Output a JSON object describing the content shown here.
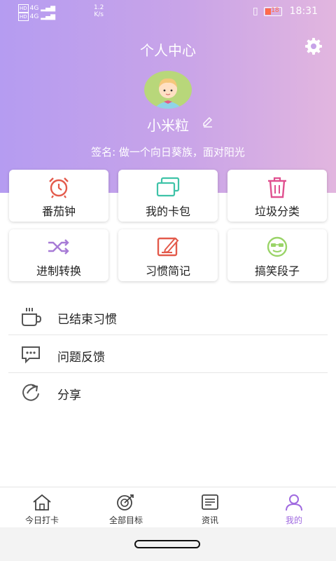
{
  "status_bar": {
    "sim1": "HD",
    "sim2": "HD",
    "net1": "4G",
    "net2": "4G",
    "speed_value": "1.2",
    "speed_unit": "K/s",
    "battery": "18",
    "time": "18:31"
  },
  "header": {
    "title": "个人中心",
    "username": "小米粒",
    "signature": "签名: 做一个向日葵族，面对阳光"
  },
  "grid": [
    {
      "label": "番茄钟",
      "icon": "alarm-clock-icon",
      "color": "#e35a4b"
    },
    {
      "label": "我的卡包",
      "icon": "cards-icon",
      "color": "#3fc3a8"
    },
    {
      "label": "垃圾分类",
      "icon": "trash-icon",
      "color": "#e0508f"
    },
    {
      "label": "进制转换",
      "icon": "shuffle-icon",
      "color": "#a77bd6"
    },
    {
      "label": "习惯简记",
      "icon": "notepad-icon",
      "color": "#e35a4b"
    },
    {
      "label": "搞笑段子",
      "icon": "smiley-icon",
      "color": "#9ad468"
    }
  ],
  "list": [
    {
      "label": "已结束习惯",
      "icon": "cup-icon"
    },
    {
      "label": "问题反馈",
      "icon": "feedback-icon"
    },
    {
      "label": "分享",
      "icon": "share-icon"
    }
  ],
  "tabs": [
    {
      "label": "今日打卡",
      "icon": "home-icon"
    },
    {
      "label": "全部目标",
      "icon": "target-icon"
    },
    {
      "label": "资讯",
      "icon": "news-icon"
    },
    {
      "label": "我的",
      "icon": "profile-icon"
    }
  ],
  "colors": {
    "accent": "#a06ae0",
    "header_start": "#b59cf1",
    "header_end": "#e2b6df"
  }
}
